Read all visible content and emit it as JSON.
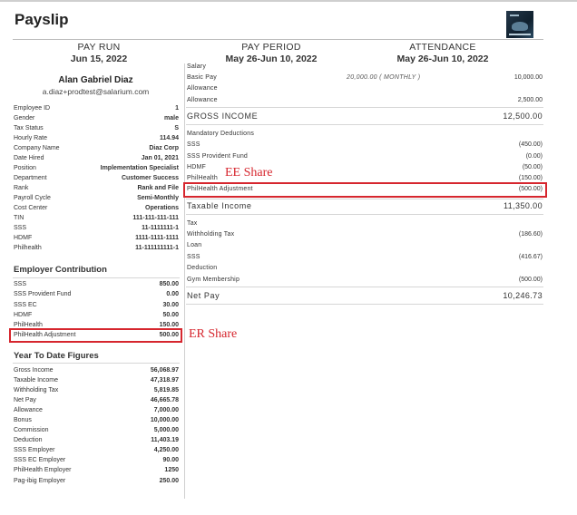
{
  "title": "Payslip",
  "logo_icon": "company-logo-image",
  "header": {
    "pay_run": {
      "label": "PAY RUN",
      "value": "Jun 15, 2022"
    },
    "pay_period": {
      "label": "PAY PERIOD",
      "value": "May 26-Jun 10, 2022"
    },
    "attendance": {
      "label": "ATTENDANCE",
      "value": "May 26-Jun 10, 2022"
    }
  },
  "employee": {
    "name": "Alan Gabriel Diaz",
    "email": "a.diaz+prodtest@salarium.com",
    "details": [
      {
        "label": "Employee ID",
        "value": "1"
      },
      {
        "label": "Gender",
        "value": "male"
      },
      {
        "label": "Tax Status",
        "value": "S"
      },
      {
        "label": "Hourly Rate",
        "value": "114.94"
      },
      {
        "label": "Company Name",
        "value": "Diaz Corp"
      },
      {
        "label": "Date Hired",
        "value": "Jan 01, 2021"
      },
      {
        "label": "Position",
        "value": "Implementation Specialist"
      },
      {
        "label": "Department",
        "value": "Customer Success"
      },
      {
        "label": "Rank",
        "value": "Rank and File"
      },
      {
        "label": "Payroll Cycle",
        "value": "Semi-Monthly"
      },
      {
        "label": "Cost Center",
        "value": "Operations"
      },
      {
        "label": "TIN",
        "value": "111-111-111-111"
      },
      {
        "label": "SSS",
        "value": "11-1111111-1"
      },
      {
        "label": "HDMF",
        "value": "1111-1111-1111"
      },
      {
        "label": "Philhealth",
        "value": "11-111111111-1"
      }
    ]
  },
  "employer_contribution": {
    "title": "Employer Contribution",
    "items": [
      {
        "label": "SSS",
        "value": "850.00"
      },
      {
        "label": "SSS Provident Fund",
        "value": "0.00"
      },
      {
        "label": "SSS EC",
        "value": "30.00"
      },
      {
        "label": "HDMF",
        "value": "50.00"
      },
      {
        "label": "PhilHealth",
        "value": "150.00"
      },
      {
        "label": "PhilHealth Adjustment",
        "value": "500.00"
      }
    ]
  },
  "ytd": {
    "title": "Year To Date Figures",
    "items": [
      {
        "label": "Gross Income",
        "value": "56,068.97"
      },
      {
        "label": "Taxable Income",
        "value": "47,318.97"
      },
      {
        "label": "Withholding Tax",
        "value": "5,819.85"
      },
      {
        "label": "Net Pay",
        "value": "46,665.78"
      },
      {
        "label": "Allowance",
        "value": "7,000.00"
      },
      {
        "label": "Bonus",
        "value": "10,000.00"
      },
      {
        "label": "Commission",
        "value": "5,000.00"
      },
      {
        "label": "Deduction",
        "value": "11,403.19"
      },
      {
        "label": "SSS Employer",
        "value": "4,250.00"
      },
      {
        "label": "SSS EC Employer",
        "value": "90.00"
      },
      {
        "label": "PhilHealth Employer",
        "value": "1250"
      },
      {
        "label": "Pag-ibig Employer",
        "value": "250.00"
      }
    ]
  },
  "earnings": {
    "salary_label": "Salary",
    "basic_pay": {
      "label": "Basic Pay",
      "memo": "20,000.00 ( MONTHLY )",
      "value": "10,000.00"
    },
    "allowance_header": "Allowance",
    "allowance": {
      "label": "Allowance",
      "value": "2,500.00"
    },
    "gross_income": {
      "label": "GROSS INCOME",
      "value": "12,500.00"
    }
  },
  "deductions": {
    "mandatory_title": "Mandatory Deductions",
    "items": [
      {
        "label": "SSS",
        "value": "(450.00)"
      },
      {
        "label": "SSS Provident Fund",
        "value": "(0.00)"
      },
      {
        "label": "HDMF",
        "value": "(50.00)"
      },
      {
        "label": "PhilHealth",
        "value": "(150.00)"
      },
      {
        "label": "PhilHealth Adjustment",
        "value": "(500.00)"
      }
    ],
    "taxable_income": {
      "label": "Taxable Income",
      "value": "11,350.00"
    },
    "tax_title": "Tax",
    "withholding_tax": {
      "label": "Withholding Tax",
      "value": "(186.60)"
    },
    "loan_title": "Loan",
    "loan_sss": {
      "label": "SSS",
      "value": "(416.67)"
    },
    "deduction_title": "Deduction",
    "gym": {
      "label": "Gym Membership",
      "value": "(500.00)"
    },
    "net_pay": {
      "label": "Net Pay",
      "value": "10,246.73"
    }
  },
  "annotations": {
    "ee_share": "EE Share",
    "er_share": "ER Share"
  },
  "colors": {
    "annotation_red": "#d6262e"
  }
}
